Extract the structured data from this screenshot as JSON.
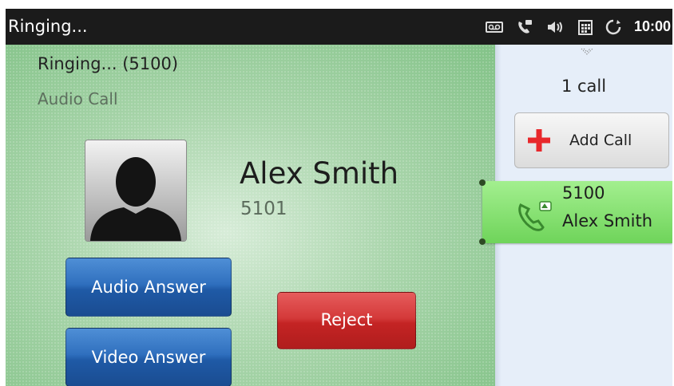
{
  "statusbar": {
    "title": "Ringing...",
    "time": "10:00",
    "icons": [
      "voicemail-icon",
      "phone-handset-icon",
      "volume-icon",
      "calendar-icon",
      "sync-icon"
    ]
  },
  "call": {
    "status_line": "Ringing... (5100)",
    "type": "Audio Call",
    "contact_name": "Alex Smith",
    "contact_number": "5101"
  },
  "actions": {
    "audio_answer": "Audio Answer",
    "video_answer": "Video Answer",
    "reject": "Reject"
  },
  "panel": {
    "call_count": "1 call",
    "add_call": "Add Call",
    "active_call": {
      "number": "5100",
      "name": "Alex Smith"
    }
  },
  "colors": {
    "answer_blue": "#2f6fbe",
    "reject_red": "#c42424",
    "active_call_green": "#6fd45a",
    "add_plus_red": "#e8282b"
  }
}
